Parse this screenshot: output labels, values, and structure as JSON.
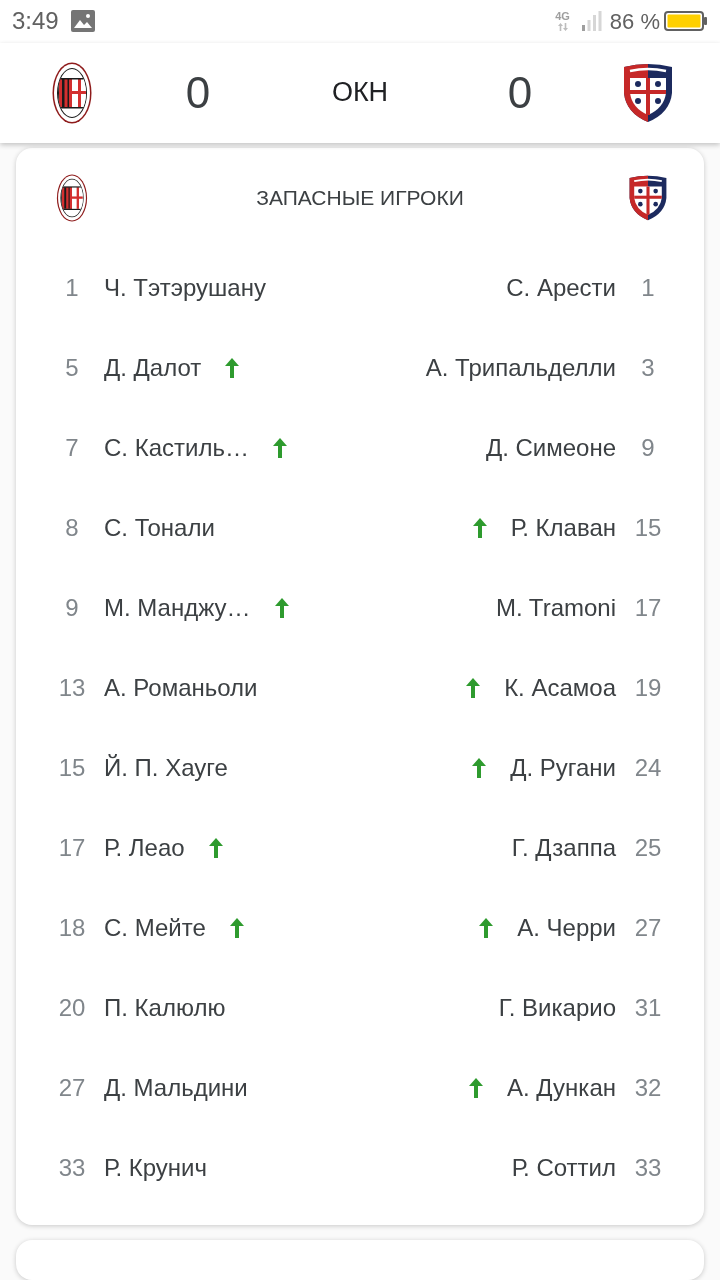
{
  "status_bar": {
    "time": "3:49",
    "network_type": "4G",
    "battery": "86 %"
  },
  "scoreboard": {
    "home_score": "0",
    "status": "ОКН",
    "away_score": "0"
  },
  "substitutes": {
    "title": "ЗАПАСНЫЕ ИГРОКИ",
    "rows": [
      {
        "home": {
          "number": "1",
          "name": "Ч. Тэтэрушану",
          "subbed_in": false
        },
        "away": {
          "number": "1",
          "name": "С. Арести",
          "subbed_in": false
        }
      },
      {
        "home": {
          "number": "5",
          "name": "Д. Далот",
          "subbed_in": true
        },
        "away": {
          "number": "3",
          "name": "А. Трипальделли",
          "subbed_in": false
        }
      },
      {
        "home": {
          "number": "7",
          "name": "С. Кастиль…",
          "subbed_in": true
        },
        "away": {
          "number": "9",
          "name": "Д. Симеоне",
          "subbed_in": false
        }
      },
      {
        "home": {
          "number": "8",
          "name": "С. Тонали",
          "subbed_in": false
        },
        "away": {
          "number": "15",
          "name": "Р. Клаван",
          "subbed_in": true
        }
      },
      {
        "home": {
          "number": "9",
          "name": "М. Манджу…",
          "subbed_in": true
        },
        "away": {
          "number": "17",
          "name": "M. Tramoni",
          "subbed_in": false
        }
      },
      {
        "home": {
          "number": "13",
          "name": "А. Романьоли",
          "subbed_in": false
        },
        "away": {
          "number": "19",
          "name": "К. Асамоа",
          "subbed_in": true
        }
      },
      {
        "home": {
          "number": "15",
          "name": "Й. П. Хауге",
          "subbed_in": false
        },
        "away": {
          "number": "24",
          "name": "Д. Ругани",
          "subbed_in": true
        }
      },
      {
        "home": {
          "number": "17",
          "name": "Р. Леао",
          "subbed_in": true
        },
        "away": {
          "number": "25",
          "name": "Г. Дзаппа",
          "subbed_in": false
        }
      },
      {
        "home": {
          "number": "18",
          "name": "С. Мейте",
          "subbed_in": true
        },
        "away": {
          "number": "27",
          "name": "А. Черри",
          "subbed_in": true
        }
      },
      {
        "home": {
          "number": "20",
          "name": "П. Калюлю",
          "subbed_in": false
        },
        "away": {
          "number": "31",
          "name": "Г. Викарио",
          "subbed_in": false
        }
      },
      {
        "home": {
          "number": "27",
          "name": "Д. Мальдини",
          "subbed_in": false
        },
        "away": {
          "number": "32",
          "name": "А. Дункан",
          "subbed_in": true
        }
      },
      {
        "home": {
          "number": "33",
          "name": "Р. Крунич",
          "subbed_in": false
        },
        "away": {
          "number": "33",
          "name": "Р. Соттил",
          "subbed_in": false
        }
      }
    ]
  }
}
